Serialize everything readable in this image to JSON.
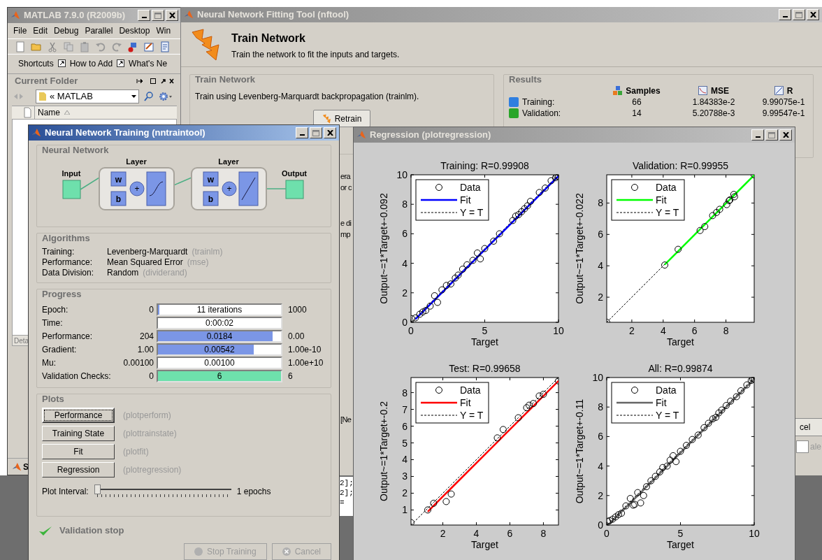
{
  "matlab_window": {
    "title": "MATLAB  7.9.0 (R2009b)",
    "active": false,
    "menu": [
      "File",
      "Edit",
      "Debug",
      "Parallel",
      "Desktop",
      "Win"
    ],
    "shortcuts": [
      "Shortcuts",
      "How to Add",
      "What's Ne"
    ],
    "current_folder": {
      "title": "Current Folder",
      "path": "« MATLAB",
      "column": "Name",
      "details": "Deta"
    },
    "start_button": "S"
  },
  "nftool_window": {
    "title": "Neural Network Fitting Tool (nftool)",
    "active": false,
    "heading": "Train Network",
    "subheading": "Train the network to fit the inputs and targets.",
    "train_group": {
      "title": "Train Network",
      "text": "Train using Levenberg-Marquardt backpropagation (trainlm).",
      "button": "Retrain"
    },
    "results": {
      "title": "Results",
      "columns": [
        "Samples",
        "MSE",
        "R"
      ],
      "rows": [
        {
          "label": "Training:",
          "samples": "66",
          "mse": "1.84383e-2",
          "r": "9.99075e-1",
          "color": "#2f7fe0"
        },
        {
          "label": "Validation:",
          "samples": "14",
          "mse": "5.20788e-3",
          "r": "9.99547e-1",
          "color": "#2aa52a"
        }
      ]
    },
    "fragments": [
      "era",
      "or c",
      "e di",
      "mp",
      "[Ne"
    ],
    "cancel_button": "cel",
    "field_fragment": "ale"
  },
  "command_window": {
    "lines": [
      "2];",
      "2];",
      "="
    ]
  },
  "nntraintool_window": {
    "title": "Neural Network Training (nntraintool)",
    "active": true,
    "network": {
      "title": "Neural Network",
      "input": "Input",
      "output": "Output",
      "layers": [
        {
          "title": "Layer",
          "weight": "w",
          "bias": "b",
          "sum": "+",
          "kind": "sigmoid"
        },
        {
          "title": "Layer",
          "weight": "w",
          "bias": "b",
          "sum": "+",
          "kind": "linear"
        }
      ]
    },
    "algorithms": {
      "title": "Algorithms",
      "rows": [
        {
          "label": "Training:",
          "value": "Levenberg-Marquardt",
          "function": "(trainlm)"
        },
        {
          "label": "Performance:",
          "value": "Mean Squared Error",
          "function": "(mse)"
        },
        {
          "label": "Data Division:",
          "value": "Random",
          "function": "(dividerand)"
        }
      ]
    },
    "progress": {
      "title": "Progress",
      "rows": [
        {
          "label": "Epoch:",
          "start": "0",
          "value": "11 iterations",
          "end": "1000",
          "level": 0.01,
          "color": "#7b96e6"
        },
        {
          "label": "Time:",
          "value": "0:00:02",
          "level": 0
        },
        {
          "label": "Performance:",
          "start": "204",
          "value": "0.0184",
          "end": "0.00",
          "level": 0.93,
          "color": "#7b96e6"
        },
        {
          "label": "Gradient:",
          "start": "1.00",
          "value": "0.00542",
          "end": "1.00e-10",
          "level": 0.78,
          "color": "#7b96e6"
        },
        {
          "label": "Mu:",
          "start": "0.00100",
          "value": "0.00100",
          "end": "1.00e+10",
          "level": 0
        },
        {
          "label": "Validation Checks:",
          "start": "0",
          "value": "6",
          "end": "6",
          "level": 1,
          "color": "#6ee0ac"
        }
      ]
    },
    "plots": {
      "title": "Plots",
      "buttons": [
        {
          "label": "Performance",
          "function": "(plotperform)",
          "focused": true
        },
        {
          "label": "Training State",
          "function": "(plottrainstate)",
          "focused": false
        },
        {
          "label": "Fit",
          "function": "(plotfit)",
          "focused": false
        },
        {
          "label": "Regression",
          "function": "(plotregression)",
          "focused": false
        }
      ],
      "interval": {
        "label": "Plot Interval:",
        "level": 0,
        "reading": "1 epochs"
      }
    },
    "status": "Validation stop",
    "buttons": [
      {
        "label": "Stop Training",
        "kind": "stop",
        "disabled": true
      },
      {
        "label": "Cancel",
        "kind": "cancel",
        "disabled": true
      }
    ]
  },
  "regression_window": {
    "title": "Regression (plotregression)",
    "active": false,
    "plots": [
      {
        "chart_data": {
          "type": "scatter",
          "title": "Training: R=0.99908",
          "xlabel": "Target",
          "ylabel": "Output~=1*Target+-0.092",
          "legend": "upper left",
          "xlim": [
            0,
            10
          ],
          "ylim": [
            0,
            10
          ],
          "xticks": [
            0,
            5,
            10
          ],
          "yticks": [
            0,
            2,
            4,
            6,
            8,
            10
          ],
          "x": [
            0.05,
            0.3,
            0.6,
            0.8,
            1.0,
            1.3,
            1.6,
            1.8,
            2.1,
            2.4,
            2.7,
            3.0,
            3.2,
            3.5,
            3.8,
            4.2,
            4.5,
            4.7,
            5.0,
            5.6,
            6.0,
            6.9,
            7.1,
            7.3,
            7.5,
            7.7,
            7.9,
            8.1,
            8.7,
            9.1,
            9.5,
            9.8,
            9.9,
            10.0
          ],
          "series": [
            {
              "name": "Data",
              "type": "scatter",
              "color": "#000000",
              "values": [
                0.25,
                0.3,
                0.55,
                0.7,
                0.8,
                1.1,
                1.8,
                1.35,
                2.2,
                2.5,
                2.6,
                3.0,
                3.2,
                3.6,
                3.9,
                4.2,
                4.7,
                4.3,
                5.0,
                5.5,
                6.0,
                6.9,
                7.2,
                7.3,
                7.5,
                7.7,
                7.9,
                8.2,
                8.8,
                9.1,
                9.6,
                9.8,
                9.9,
                9.9
              ]
            },
            {
              "name": "Fit",
              "type": "line",
              "color": "#0000ff",
              "values": [
                null,
                0.21,
                0.51,
                0.71,
                0.91,
                1.21,
                1.51,
                1.71,
                2.01,
                2.31,
                2.61,
                2.91,
                3.11,
                3.41,
                3.71,
                4.11,
                4.41,
                4.61,
                4.91,
                5.51,
                5.91,
                6.81,
                7.01,
                7.21,
                7.41,
                7.61,
                7.81,
                8.01,
                8.61,
                9.01,
                9.41,
                9.71,
                9.81,
                9.91
              ]
            },
            {
              "name": "Y = T",
              "type": "line",
              "line_style": "dashed",
              "color": "#000000",
              "values": [
                0.05,
                0.3,
                0.6,
                0.8,
                1.0,
                1.3,
                1.6,
                1.8,
                2.1,
                2.4,
                2.7,
                3.0,
                3.2,
                3.5,
                3.8,
                4.2,
                4.5,
                4.7,
                5.0,
                5.6,
                6.0,
                6.9,
                7.1,
                7.3,
                7.5,
                7.7,
                7.9,
                8.1,
                8.7,
                9.1,
                9.5,
                9.8,
                9.9,
                10.0
              ]
            }
          ]
        }
      },
      {
        "chart_data": {
          "type": "scatter",
          "title": "Validation: R=0.99955",
          "xlabel": "Target",
          "ylabel": "Output~=1*Target+-0.022",
          "legend": "upper left",
          "xlim": [
            0.4,
            9.8
          ],
          "ylim": [
            0.4,
            9.8
          ],
          "xticks": [
            2,
            4,
            6,
            8
          ],
          "yticks": [
            2,
            4,
            6,
            8
          ],
          "x": [
            0.4,
            4.1,
            4.95,
            6.35,
            6.65,
            7.15,
            7.4,
            7.6,
            8.05,
            8.2,
            8.25,
            8.5,
            8.55,
            9.8
          ],
          "series": [
            {
              "name": "Data",
              "type": "scatter",
              "color": "#000000",
              "values": [
                0.4,
                4.05,
                5.05,
                6.25,
                6.5,
                7.2,
                7.4,
                7.6,
                7.9,
                8.15,
                8.2,
                8.55,
                8.4,
                9.8
              ]
            },
            {
              "name": "Fit",
              "type": "line",
              "color": "#00ff00",
              "values": [
                null,
                4.08,
                4.93,
                6.33,
                6.63,
                7.13,
                7.38,
                7.58,
                8.03,
                8.18,
                8.23,
                8.48,
                8.53,
                9.78
              ]
            },
            {
              "name": "Y = T",
              "type": "line",
              "line_style": "dashed",
              "color": "#000000",
              "values": [
                0.4,
                4.1,
                4.95,
                6.35,
                6.65,
                7.15,
                7.4,
                7.6,
                8.05,
                8.2,
                8.25,
                8.5,
                8.55,
                9.8
              ]
            }
          ]
        }
      },
      {
        "chart_data": {
          "type": "scatter",
          "title": "Test: R=0.99658",
          "xlabel": "Target",
          "ylabel": "Output~=1*Target+-0.2",
          "legend": "upper left",
          "xlim": [
            0.1,
            8.9
          ],
          "ylim": [
            0.1,
            8.9
          ],
          "xticks": [
            2,
            4,
            6,
            8
          ],
          "yticks": [
            1,
            2,
            3,
            4,
            5,
            6,
            7,
            8
          ],
          "x": [
            0.1,
            1.1,
            1.45,
            2.2,
            2.5,
            5.25,
            5.6,
            6.5,
            7.0,
            7.15,
            7.4,
            7.75,
            8.0,
            8.9
          ],
          "series": [
            {
              "name": "Data",
              "type": "scatter",
              "color": "#000000",
              "values": [
                0.25,
                1.0,
                1.4,
                1.5,
                1.95,
                5.3,
                5.8,
                6.5,
                7.1,
                7.25,
                7.35,
                7.8,
                7.9,
                8.7
              ]
            },
            {
              "name": "Fit",
              "type": "line",
              "color": "#ff0000",
              "values": [
                null,
                0.9,
                1.25,
                2.0,
                2.3,
                5.05,
                5.4,
                6.3,
                6.8,
                6.95,
                7.2,
                7.55,
                7.8,
                8.7
              ]
            },
            {
              "name": "Y = T",
              "type": "line",
              "line_style": "dashed",
              "color": "#000000",
              "values": [
                0.1,
                1.1,
                1.45,
                2.2,
                2.5,
                5.25,
                5.6,
                6.5,
                7.0,
                7.15,
                7.4,
                7.75,
                8.0,
                8.9
              ]
            }
          ]
        }
      },
      {
        "chart_data": {
          "type": "scatter",
          "title": "All: R=0.99874",
          "xlabel": "Target",
          "ylabel": "Output~=1*Target+-0.11",
          "legend": "upper left",
          "xlim": [
            0,
            10
          ],
          "ylim": [
            0,
            10
          ],
          "xticks": [
            0,
            5,
            10
          ],
          "yticks": [
            0,
            2,
            4,
            6,
            8,
            10
          ],
          "x": [
            0.05,
            0.2,
            0.4,
            0.6,
            0.8,
            1.0,
            1.3,
            1.6,
            1.8,
            1.9,
            2.1,
            2.3,
            2.5,
            2.7,
            3.0,
            3.3,
            3.6,
            3.8,
            4.1,
            4.3,
            4.5,
            4.7,
            5.0,
            5.4,
            5.8,
            6.2,
            6.6,
            6.9,
            7.2,
            7.4,
            7.6,
            7.8,
            8.1,
            8.4,
            8.8,
            9.1,
            9.5,
            9.8,
            9.9,
            10.0
          ],
          "series": [
            {
              "name": "Data",
              "type": "scatter",
              "color": "#000000",
              "values": [
                0.25,
                0.3,
                0.4,
                0.55,
                0.7,
                0.8,
                1.3,
                1.8,
                1.35,
                1.4,
                2.2,
                1.5,
                2.0,
                2.6,
                3.0,
                3.3,
                3.6,
                3.9,
                4.0,
                4.4,
                4.7,
                4.3,
                5.0,
                5.4,
                5.8,
                6.1,
                6.6,
                6.9,
                7.2,
                7.3,
                7.6,
                7.8,
                8.1,
                8.4,
                8.7,
                9.1,
                9.5,
                9.8,
                9.9,
                9.9
              ]
            },
            {
              "name": "Fit",
              "type": "line",
              "color": "#666666",
              "values": [
                null,
                0.09,
                0.29,
                0.49,
                0.69,
                0.89,
                1.19,
                1.49,
                1.69,
                1.79,
                1.99,
                2.19,
                2.39,
                2.59,
                2.89,
                3.19,
                3.49,
                3.69,
                3.99,
                4.19,
                4.39,
                4.59,
                4.89,
                5.29,
                5.69,
                6.09,
                6.49,
                6.79,
                7.09,
                7.29,
                7.49,
                7.69,
                7.99,
                8.29,
                8.69,
                8.99,
                9.39,
                9.69,
                9.79,
                9.89
              ]
            },
            {
              "name": "Y = T",
              "type": "line",
              "line_style": "dashed",
              "color": "#000000",
              "values": [
                0.05,
                0.2,
                0.4,
                0.6,
                0.8,
                1.0,
                1.3,
                1.6,
                1.8,
                1.9,
                2.1,
                2.3,
                2.5,
                2.7,
                3.0,
                3.3,
                3.6,
                3.8,
                4.1,
                4.3,
                4.5,
                4.7,
                5.0,
                5.4,
                5.8,
                6.2,
                6.6,
                6.9,
                7.2,
                7.4,
                7.6,
                7.8,
                8.1,
                8.4,
                8.8,
                9.1,
                9.5,
                9.8,
                9.9,
                10.0
              ]
            }
          ]
        }
      }
    ]
  }
}
